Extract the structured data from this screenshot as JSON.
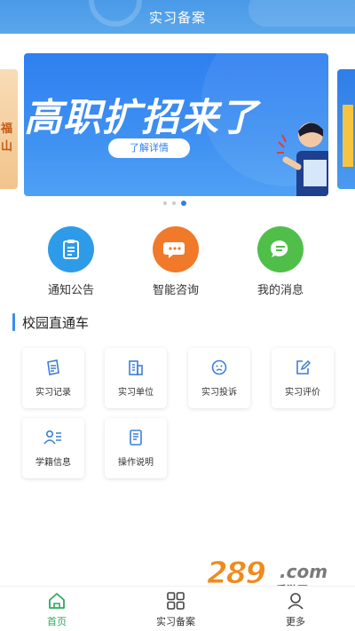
{
  "header": {
    "title": "实习备案"
  },
  "banner": {
    "title": "高职扩招来了",
    "button_label": "了解详情",
    "side_left_text": "福 山",
    "active_slide": 3,
    "slide_count": 3
  },
  "quick_actions": [
    {
      "label": "通知公告",
      "icon": "clipboard-icon",
      "color": "#2e9be8"
    },
    {
      "label": "智能咨询",
      "icon": "chat-bubbles-icon",
      "color": "#f07a2a"
    },
    {
      "label": "我的消息",
      "icon": "message-icon",
      "color": "#4fbf4a"
    }
  ],
  "section": {
    "title": "校园直通车"
  },
  "tiles": [
    {
      "label": "实习记录",
      "icon": "record-icon"
    },
    {
      "label": "实习单位",
      "icon": "building-icon"
    },
    {
      "label": "实习投诉",
      "icon": "complaint-icon"
    },
    {
      "label": "实习评价",
      "icon": "edit-icon"
    },
    {
      "label": "学籍信息",
      "icon": "student-card-icon"
    },
    {
      "label": "操作说明",
      "icon": "document-icon"
    }
  ],
  "tabbar": [
    {
      "label": "首页",
      "icon": "home-icon",
      "active": true
    },
    {
      "label": "实习备案",
      "icon": "grid-icon",
      "active": false
    },
    {
      "label": "更多",
      "icon": "more-icon",
      "active": false
    }
  ],
  "watermark": {
    "number": "289",
    "domain": ".com",
    "subtitle": "手游网"
  },
  "colors": {
    "primary": "#3b8df0",
    "active_tab": "#2eaa5c",
    "icon_blue": "#3d7fd6"
  }
}
